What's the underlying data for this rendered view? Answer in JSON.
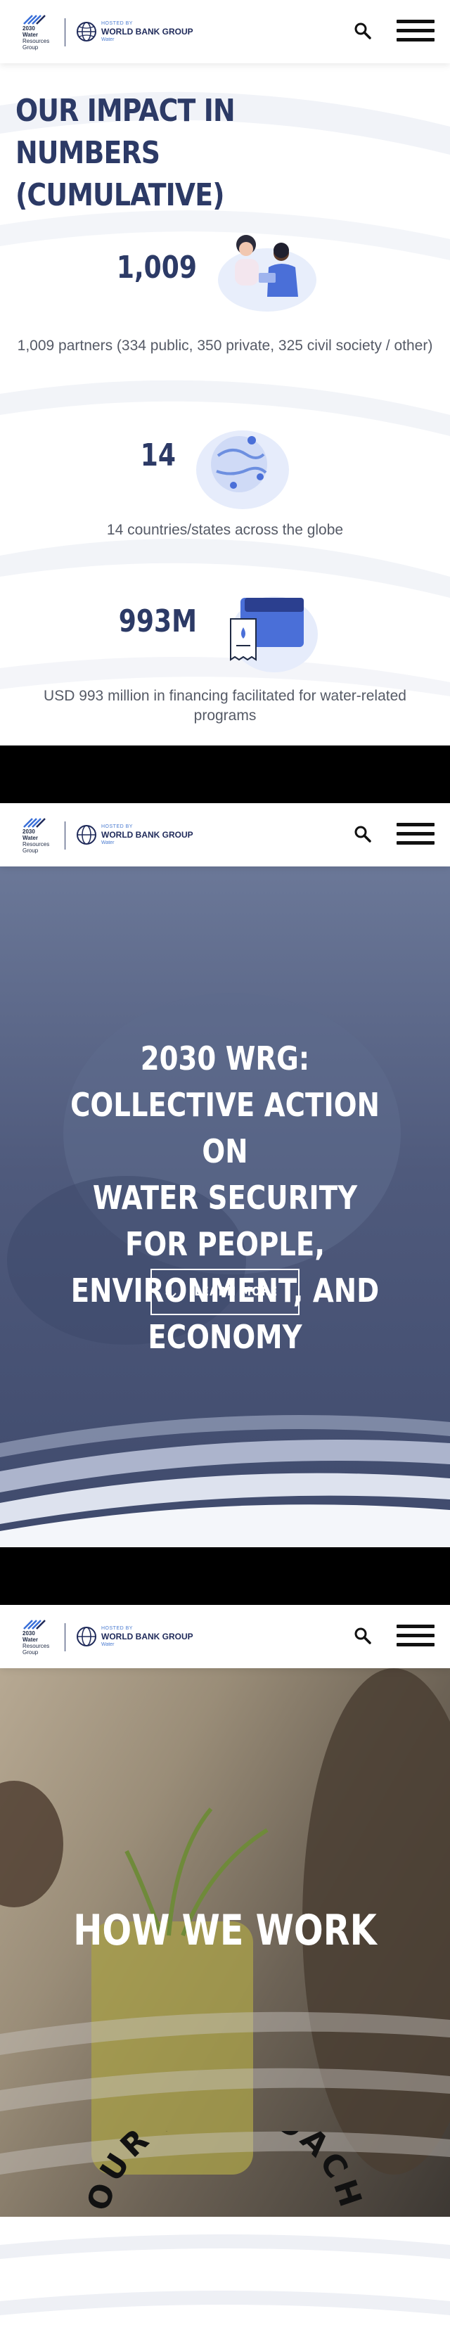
{
  "header": {
    "logo_lines": [
      "2030",
      "Water",
      "Resources",
      "Group"
    ],
    "hosted_by": "HOSTED BY",
    "org_name": "WORLD BANK GROUP",
    "org_sub": "Water"
  },
  "impact": {
    "title_line1": "OUR IMPACT IN NUMBERS",
    "title_line2": "(CUMULATIVE)",
    "stats": [
      {
        "value": "1,009",
        "description": "1,009 partners (334 public, 350 private, 325 civil society / other)",
        "icon": "partners-illustration"
      },
      {
        "value": "14",
        "description": "14 countries/states across the globe",
        "icon": "globe-illustration"
      },
      {
        "value": "993M",
        "description": "USD 993 million in financing facilitated for water-related programs",
        "icon": "wallet-illustration"
      }
    ]
  },
  "hero": {
    "title_lines": [
      "2030 WRG: COLLECTIVE ACTION ON",
      "WATER SECURITY",
      "FOR PEOPLE, ENVIRONMENT, AND",
      "ECONOMY"
    ],
    "button_label": "LEARN MORE",
    "button_icon": "arrow-down-icon"
  },
  "how": {
    "title": "HOW WE WORK",
    "approach": "OUR APPROACH"
  },
  "colors": {
    "navy": "#2c3a66",
    "hero_blue": "#4f5a7c",
    "text_gray": "#555a66"
  }
}
